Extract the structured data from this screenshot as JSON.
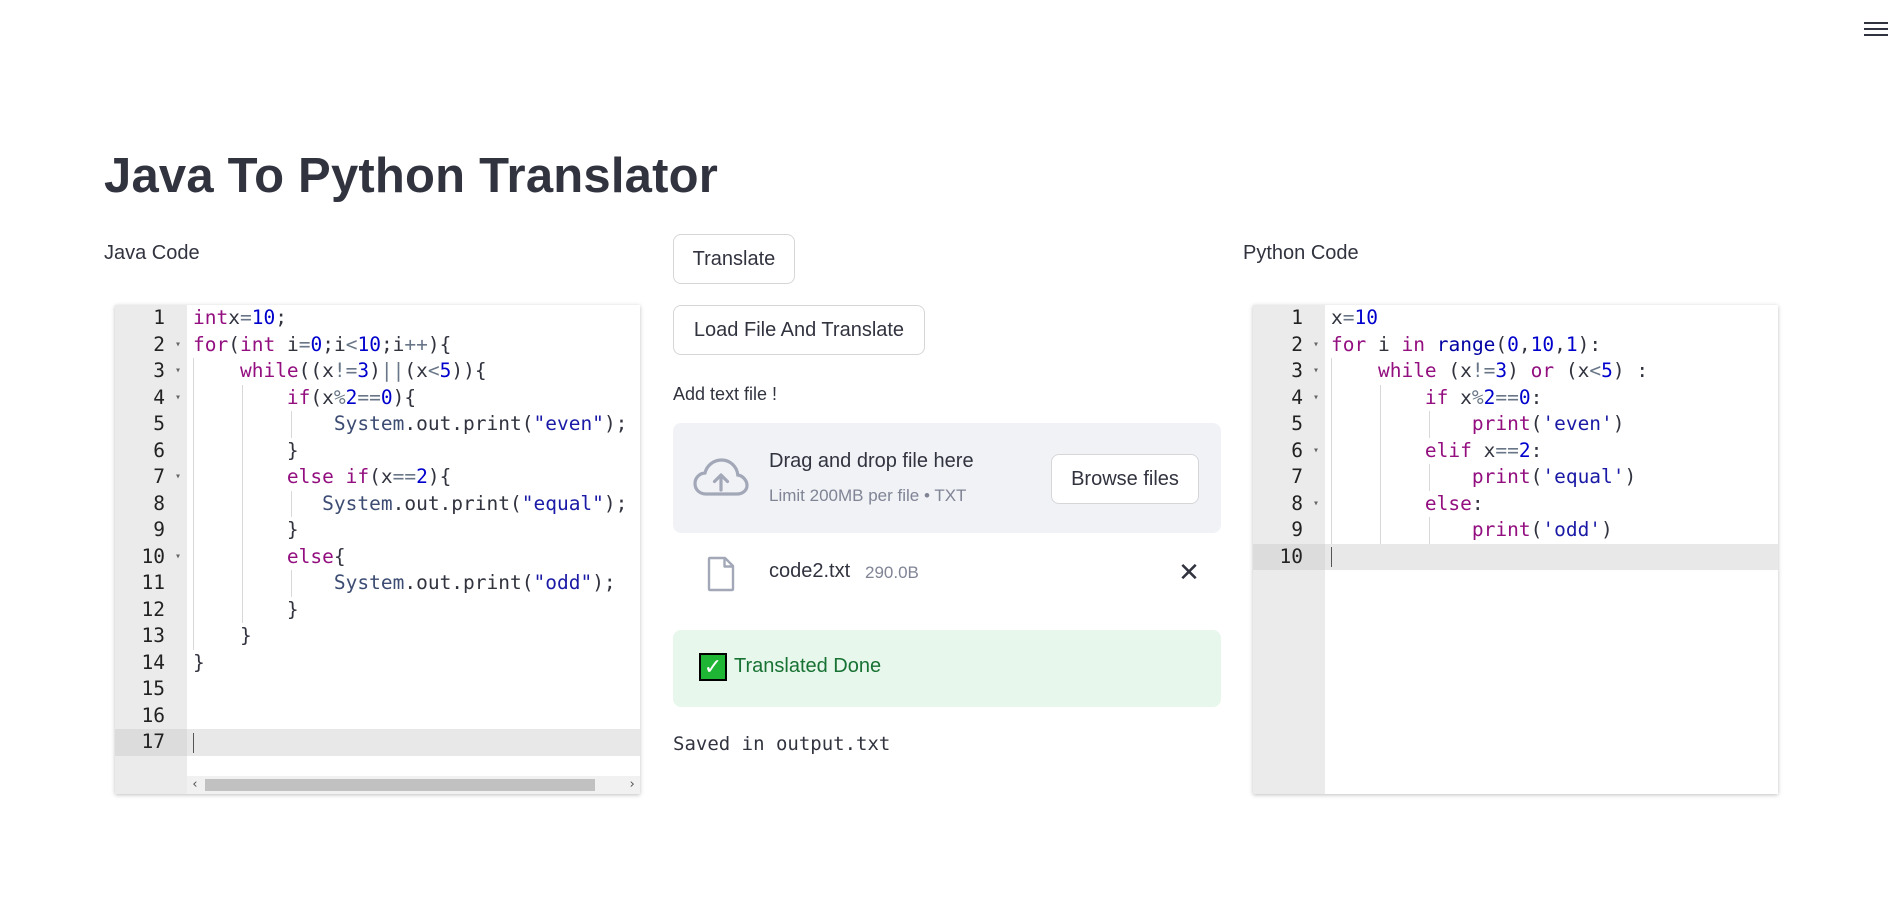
{
  "app": {
    "title": "Java To Python Translator",
    "menu_icon": "hamburger-menu-icon"
  },
  "java": {
    "label": "Java Code",
    "line_numbers": [
      "1",
      "2",
      "3",
      "4",
      "5",
      "6",
      "7",
      "8",
      "9",
      "10",
      "11",
      "12",
      "13",
      "14",
      "15",
      "16",
      "17"
    ],
    "folds": [
      false,
      true,
      true,
      true,
      false,
      false,
      true,
      false,
      false,
      true,
      false,
      false,
      false,
      false,
      false,
      false,
      false
    ],
    "active_line": 17,
    "lines": [
      [
        [
          "kw",
          "int"
        ],
        [
          "",
          "x"
        ],
        [
          "op",
          "="
        ],
        [
          "num",
          "10"
        ],
        [
          "",
          ";"
        ]
      ],
      [
        [
          "kw",
          "for"
        ],
        [
          "",
          "("
        ],
        [
          "kw",
          "int"
        ],
        [
          "",
          ""
        ],
        [
          "",
          "i"
        ],
        [
          "op",
          "="
        ],
        [
          "num",
          "0"
        ],
        [
          "",
          ";i"
        ],
        [
          "op",
          "<"
        ],
        [
          "num",
          "10"
        ],
        [
          "",
          ";i"
        ],
        [
          "op",
          "++"
        ],
        [
          "",
          "){"
        ]
      ],
      [
        [
          "",
          "    "
        ],
        [
          "kw",
          "while"
        ],
        [
          "",
          "((x"
        ],
        [
          "op",
          "!="
        ],
        [
          "num",
          "3"
        ],
        [
          "",
          ")"
        ],
        [
          "op",
          "||"
        ],
        [
          "",
          "(x"
        ],
        [
          "op",
          "<"
        ],
        [
          "num",
          "5"
        ],
        [
          "",
          ")){"
        ]
      ],
      [
        [
          "",
          "        "
        ],
        [
          "kw",
          "if"
        ],
        [
          "",
          "(x"
        ],
        [
          "op",
          "%"
        ],
        [
          "num",
          "2"
        ],
        [
          "op",
          "=="
        ],
        [
          "num",
          "0"
        ],
        [
          "",
          "){"
        ]
      ],
      [
        [
          "",
          "            "
        ],
        [
          "fn",
          "System"
        ],
        [
          "",
          ".out.print("
        ],
        [
          "str",
          "\"even\""
        ],
        [
          "",
          ");"
        ]
      ],
      [
        [
          "",
          "        }"
        ]
      ],
      [
        [
          "",
          "        "
        ],
        [
          "kw",
          "else"
        ],
        [
          "",
          ""
        ],
        [
          "kw",
          "if"
        ],
        [
          "",
          "(x"
        ],
        [
          "op",
          "=="
        ],
        [
          "num",
          "2"
        ],
        [
          "",
          "){"
        ]
      ],
      [
        [
          "",
          "           "
        ],
        [
          "fn",
          "System"
        ],
        [
          "",
          ".out.print("
        ],
        [
          "str",
          "\"equal\""
        ],
        [
          "",
          ");"
        ]
      ],
      [
        [
          "",
          "        }"
        ]
      ],
      [
        [
          "",
          "        "
        ],
        [
          "kw",
          "else"
        ],
        [
          "",
          "{"
        ]
      ],
      [
        [
          "",
          "            "
        ],
        [
          "fn",
          "System"
        ],
        [
          "",
          ".out.print("
        ],
        [
          "str",
          "\"odd\""
        ],
        [
          "",
          ");"
        ]
      ],
      [
        [
          "",
          "        }"
        ]
      ],
      [
        [
          "",
          "    }"
        ]
      ],
      [
        [
          "",
          "}"
        ]
      ],
      [],
      [],
      []
    ]
  },
  "python": {
    "label": "Python Code",
    "line_numbers": [
      "1",
      "2",
      "3",
      "4",
      "5",
      "6",
      "7",
      "8",
      "9",
      "10"
    ],
    "folds": [
      false,
      true,
      true,
      true,
      false,
      true,
      false,
      true,
      false,
      false
    ],
    "active_line": 10,
    "lines": [
      [
        [
          "",
          "x"
        ],
        [
          "op",
          "="
        ],
        [
          "num",
          "10"
        ]
      ],
      [
        [
          "kw",
          "for"
        ],
        [
          "",
          ""
        ],
        [
          "",
          "i"
        ],
        [
          "",
          ""
        ],
        [
          "kw",
          "in"
        ],
        [
          "",
          ""
        ],
        [
          "kwb",
          "range"
        ],
        [
          "",
          "("
        ],
        [
          "num",
          "0"
        ],
        [
          "",
          ","
        ],
        [
          "num",
          "10"
        ],
        [
          "",
          ","
        ],
        [
          "num",
          "1"
        ],
        [
          "",
          "):"
        ]
      ],
      [
        [
          "",
          "    "
        ],
        [
          "kw",
          "while"
        ],
        [
          "",
          ""
        ],
        [
          "",
          "(x"
        ],
        [
          "op",
          "!="
        ],
        [
          "num",
          "3"
        ],
        [
          "",
          ")"
        ],
        [
          "",
          ""
        ],
        [
          "kw",
          "or"
        ],
        [
          "",
          ""
        ],
        [
          "",
          "(x"
        ],
        [
          "op",
          "<"
        ],
        [
          "num",
          "5"
        ],
        [
          "",
          ") :"
        ]
      ],
      [
        [
          "",
          "        "
        ],
        [
          "kw",
          "if"
        ],
        [
          "",
          ""
        ],
        [
          "",
          "x"
        ],
        [
          "op",
          "%"
        ],
        [
          "num",
          "2"
        ],
        [
          "op",
          "=="
        ],
        [
          "num",
          "0"
        ],
        [
          "",
          ":"
        ]
      ],
      [
        [
          "",
          "            "
        ],
        [
          "kw",
          "print"
        ],
        [
          "",
          "("
        ],
        [
          "str",
          "'even'"
        ],
        [
          "",
          ")"
        ]
      ],
      [
        [
          "",
          "        "
        ],
        [
          "kw",
          "elif"
        ],
        [
          "",
          ""
        ],
        [
          "",
          "x"
        ],
        [
          "op",
          "=="
        ],
        [
          "num",
          "2"
        ],
        [
          "",
          ":"
        ]
      ],
      [
        [
          "",
          "            "
        ],
        [
          "kw",
          "print"
        ],
        [
          "",
          "("
        ],
        [
          "str",
          "'equal'"
        ],
        [
          "",
          ")"
        ]
      ],
      [
        [
          "",
          "        "
        ],
        [
          "kw",
          "else"
        ],
        [
          "",
          ":"
        ]
      ],
      [
        [
          "",
          "            "
        ],
        [
          "kw",
          "print"
        ],
        [
          "",
          "("
        ],
        [
          "str",
          "'odd'"
        ],
        [
          "",
          ")"
        ]
      ],
      []
    ]
  },
  "actions": {
    "translate_label": "Translate",
    "load_file_label": "Load File And Translate"
  },
  "uploader": {
    "label": "Add text file !",
    "drag_title": "Drag and drop file here",
    "limit": "Limit 200MB per file • TXT",
    "browse_label": "Browse files",
    "file_name": "code2.txt",
    "file_size": "290.0B",
    "close_symbol": "✕"
  },
  "status": {
    "success_text": "Translated Done",
    "check_symbol": "✓",
    "saved_text": "Saved in output.txt"
  },
  "colors": {
    "keyword": "#930f80",
    "number": "#0000cd",
    "string": "#1a1aa6",
    "success_bg": "#e8f7ec",
    "success_text": "#177233",
    "check_green": "#1fb535"
  }
}
